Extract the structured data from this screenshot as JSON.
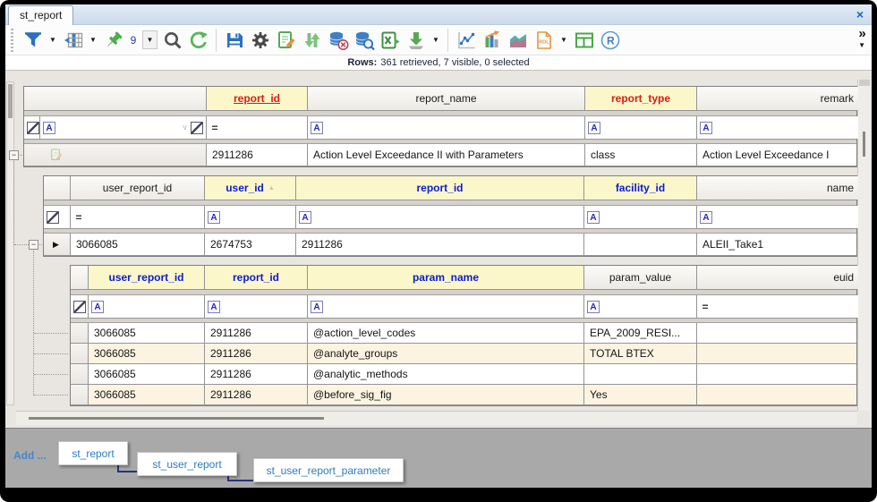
{
  "window": {
    "close": "×"
  },
  "tabs": [
    {
      "label": "st_report"
    }
  ],
  "toolbar": {
    "pin_count": "9",
    "rdl_label": "RDL",
    "r_label": "R",
    "icons": [
      "grip",
      "filter",
      "dropdown",
      "freeze-columns",
      "dropdown",
      "pin",
      "pin-count",
      "dropdown",
      "search",
      "refresh",
      "save",
      "settings",
      "edit-form",
      "sort-updown",
      "db-delete",
      "db-find",
      "excel-export",
      "download",
      "dropdown",
      "line-chart",
      "bar-chart",
      "area-chart",
      "rdl-report",
      "dropdown",
      "table-layout",
      "r-script",
      "overflow"
    ]
  },
  "status": {
    "label": "Rows:",
    "text": "361 retrieved, 7 visible, 0 selected"
  },
  "icons": {
    "text_filter": "A",
    "numeric_filter": "=",
    "collapse": "−",
    "row_marker": "▶",
    "sort_asc": "▲",
    "chevron": "∨",
    "dropdown": "▼",
    "overflow_chevron": "»"
  },
  "grids": [
    {
      "table": "st_report",
      "columns": [
        {
          "label": "report_id"
        },
        {
          "label": "report_name"
        },
        {
          "label": "report_type"
        },
        {
          "label": "remark"
        }
      ],
      "rows": [
        [
          "2911286",
          "Action Level Exceedance II with Parameters",
          "class",
          "Action Level Exceedance I"
        ]
      ]
    },
    {
      "table": "st_user_report",
      "columns": [
        {
          "label": "user_report_id"
        },
        {
          "label": "user_id"
        },
        {
          "label": "report_id"
        },
        {
          "label": "facility_id"
        },
        {
          "label": "name"
        }
      ],
      "rows": [
        [
          "3066085",
          "2674753",
          "2911286",
          "",
          "ALEII_Take1"
        ]
      ]
    },
    {
      "table": "st_user_report_parameter",
      "columns": [
        {
          "label": "user_report_id"
        },
        {
          "label": "report_id"
        },
        {
          "label": "param_name"
        },
        {
          "label": "param_value"
        },
        {
          "label": "euid"
        }
      ],
      "rows": [
        [
          "3066085",
          "2911286",
          "@action_level_codes",
          "EPA_2009_RESI...",
          ""
        ],
        [
          "3066085",
          "2911286",
          "@analyte_groups",
          "TOTAL BTEX",
          ""
        ],
        [
          "3066085",
          "2911286",
          "@analytic_methods",
          "",
          ""
        ],
        [
          "3066085",
          "2911286",
          "@before_sig_fig",
          "Yes",
          ""
        ]
      ]
    }
  ],
  "bottom_panel": {
    "add_label": "Add ...",
    "tables": [
      {
        "label": "st_report"
      },
      {
        "label": "st_user_report"
      },
      {
        "label": "st_user_report_parameter"
      }
    ]
  }
}
